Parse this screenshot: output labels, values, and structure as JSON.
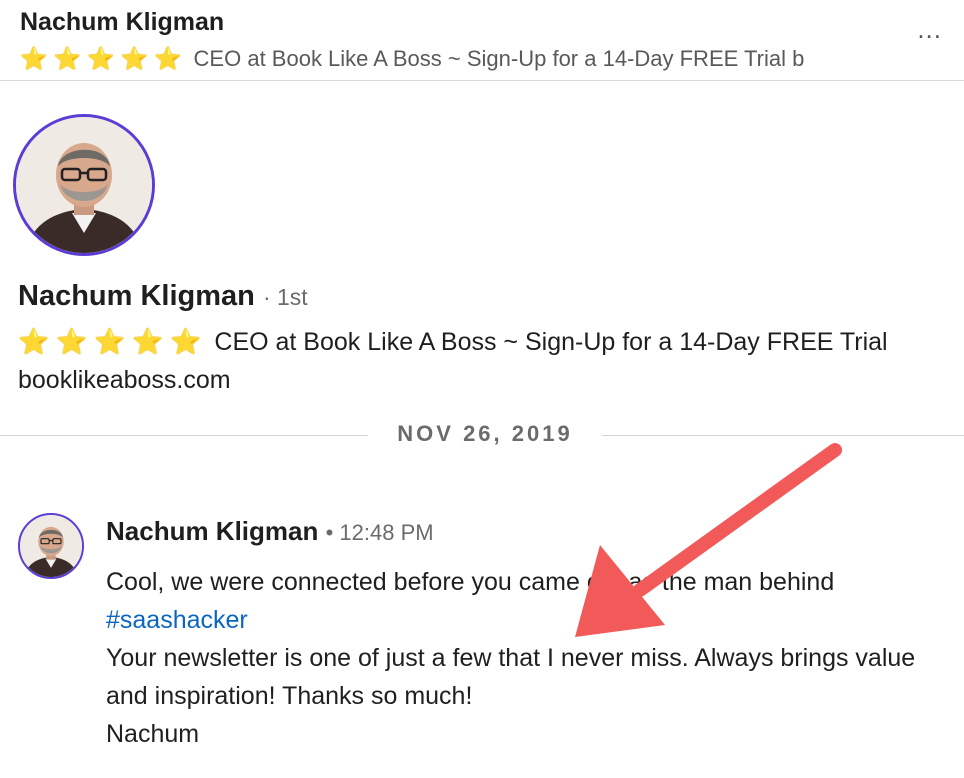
{
  "header": {
    "name": "Nachum Kligman",
    "stars": "⭐ ⭐ ⭐ ⭐ ⭐",
    "headline_truncated": "CEO at Book Like A Boss ~ Sign-Up for a 14-Day FREE Trial b",
    "more_label": "..."
  },
  "profile": {
    "name": "Nachum Kligman",
    "degree": "· 1st",
    "stars": "⭐ ⭐ ⭐ ⭐ ⭐",
    "headline": "CEO at Book Like A Boss ~ Sign-Up for a 14-Day FREE Trial booklikeaboss.com"
  },
  "date_divider": "NOV 26, 2019",
  "message": {
    "sender": "Nachum Kligman",
    "time": "• 12:48 PM",
    "line1": "Cool, we were connected before you came out as the man behind",
    "hashtag": "#saashacker",
    "line2": "Your newsletter is one of just a few that I never miss. Always brings value and inspiration! Thanks so much!",
    "signature": "Nachum"
  },
  "colors": {
    "accent": "#0a66c2",
    "avatar_ring": "#5b3dd6",
    "annotation_arrow": "#f25a5a"
  },
  "icons": {
    "more": "more-horizontal-icon",
    "rating": "star-icon"
  }
}
